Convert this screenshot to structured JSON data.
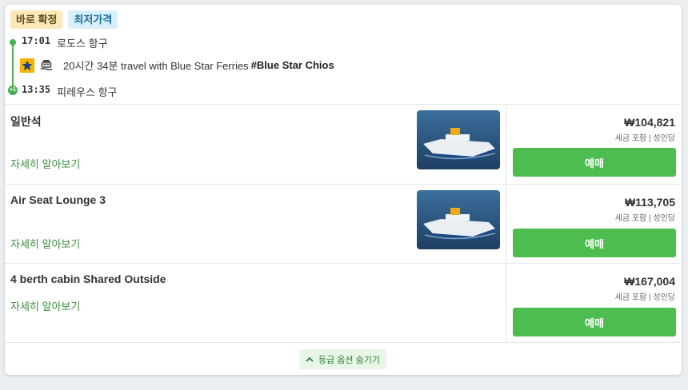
{
  "badges": {
    "confirm": "바로 확정",
    "lowest": "최저가격"
  },
  "departure": {
    "time": "17:01",
    "port": "로도스 항구"
  },
  "arrival": {
    "time": "13:35",
    "port": "피레우스 항구",
    "day_offset": "+1"
  },
  "voyage": {
    "duration_text": "20시간 34분 travel with Blue Star Ferries ",
    "vessel": "#Blue Star Chios",
    "operator_icon": "blue-star-ferries-logo",
    "transport_icon": "ship-icon"
  },
  "classes": [
    {
      "name": "일반석",
      "more": "자세히 알아보기",
      "price": "₩104,821",
      "note": "세금 포함 | 성인당",
      "button": "예매",
      "has_image": true
    },
    {
      "name": "Air Seat Lounge 3",
      "more": "자세히 알아보기",
      "price": "₩113,705",
      "note": "세금 포함 | 성인당",
      "button": "예매",
      "has_image": true
    },
    {
      "name": "4 berth cabin Shared Outside",
      "more": "자세히 알아보기",
      "price": "₩167,004",
      "note": "세금 포함 | 성인당",
      "button": "예매",
      "has_image": false
    }
  ],
  "footer": {
    "toggle_label": "등급 옵션 숨기기",
    "icon": "chevron-up-icon"
  },
  "colors": {
    "accent_green": "#4cbd4e",
    "link_green": "#3a8b3c",
    "badge_confirm_bg": "#fde8b8",
    "badge_lowest_bg": "#d7f0fb"
  }
}
